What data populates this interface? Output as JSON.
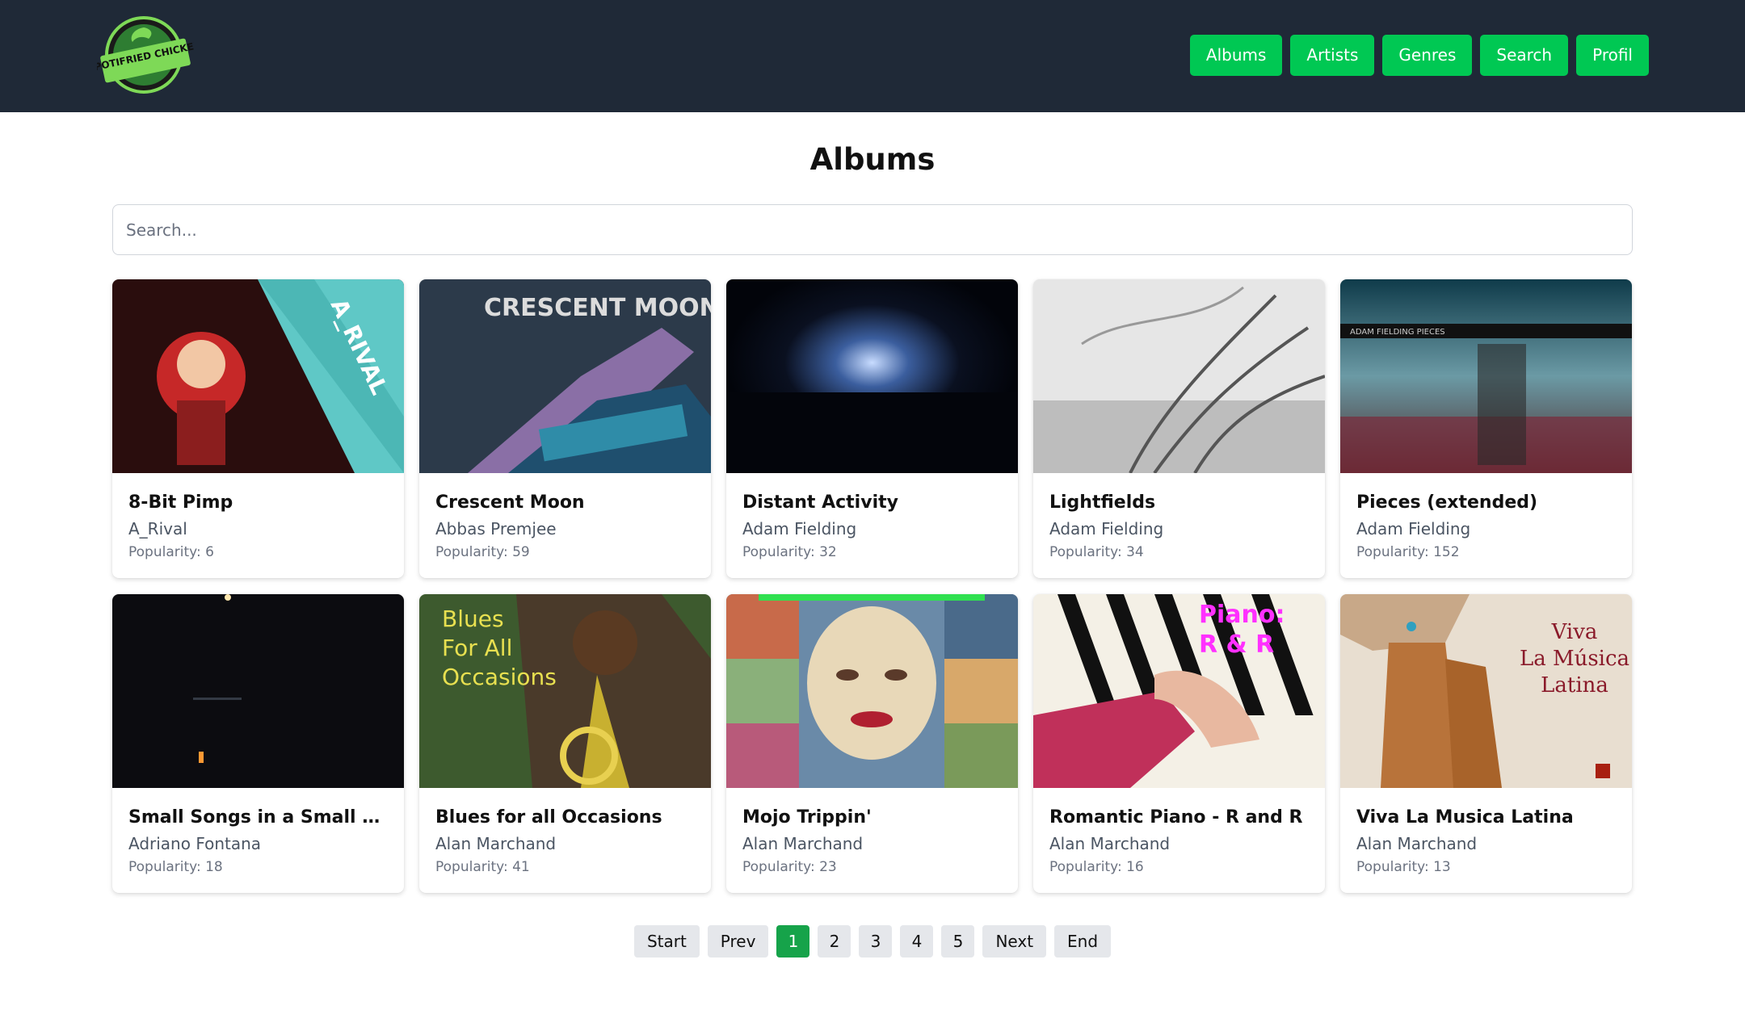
{
  "header": {
    "logo_text": "SPOTIFRIED CHICKEN",
    "nav": [
      "Albums",
      "Artists",
      "Genres",
      "Search",
      "Profil"
    ]
  },
  "page_title": "Albums",
  "search": {
    "placeholder": "Search...",
    "value": ""
  },
  "albums": [
    {
      "title": "8-Bit Pimp",
      "artist": "A_Rival",
      "popularity": "Popularity: 6",
      "cover_text": "A_RIVAL"
    },
    {
      "title": "Crescent Moon",
      "artist": "Abbas Premjee",
      "popularity": "Popularity: 59",
      "cover_text": "CRESCENT MOON"
    },
    {
      "title": "Distant Activity",
      "artist": "Adam Fielding",
      "popularity": "Popularity: 32",
      "cover_text": ""
    },
    {
      "title": "Lightfields",
      "artist": "Adam Fielding",
      "popularity": "Popularity: 34",
      "cover_text": ""
    },
    {
      "title": "Pieces (extended)",
      "artist": "Adam Fielding",
      "popularity": "Popularity: 152",
      "cover_text": "ADAM FIELDING PIECES"
    },
    {
      "title": "Small Songs in a Small Kitc...",
      "artist": "Adriano Fontana",
      "popularity": "Popularity: 18",
      "cover_text": ""
    },
    {
      "title": "Blues for all Occasions",
      "artist": "Alan Marchand",
      "popularity": "Popularity: 41",
      "cover_text": "Blues For All Occasions"
    },
    {
      "title": "Mojo Trippin'",
      "artist": "Alan Marchand",
      "popularity": "Popularity: 23",
      "cover_text": ""
    },
    {
      "title": "Romantic Piano - R and R",
      "artist": "Alan Marchand",
      "popularity": "Popularity: 16",
      "cover_text": "Piano: R & R"
    },
    {
      "title": "Viva La Musica Latina",
      "artist": "Alan Marchand",
      "popularity": "Popularity: 13",
      "cover_text": "Viva La Música Latina"
    }
  ],
  "pagination": {
    "start": "Start",
    "prev": "Prev",
    "pages": [
      "1",
      "2",
      "3",
      "4",
      "5"
    ],
    "active": "1",
    "next": "Next",
    "end": "End"
  },
  "colors": {
    "header_bg": "#1f2937",
    "nav_button": "#00c853",
    "active_page": "#16a34a"
  }
}
